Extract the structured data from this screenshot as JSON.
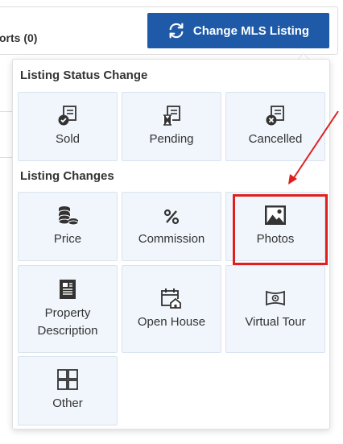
{
  "topbar": {
    "reports_label": "orts",
    "reports_count": "(0)",
    "change_button_label": "Change MLS Listing"
  },
  "dropdown": {
    "status_section_title": "Listing Status Change",
    "changes_section_title": "Listing Changes",
    "status_items": [
      {
        "label": "Sold",
        "icon": "sold-icon"
      },
      {
        "label": "Pending",
        "icon": "pending-icon"
      },
      {
        "label": "Cancelled",
        "icon": "cancelled-icon"
      }
    ],
    "change_items": [
      {
        "label": "Price",
        "icon": "coins-icon"
      },
      {
        "label": "Commission",
        "icon": "percent-icon"
      },
      {
        "label": "Photos",
        "icon": "photo-icon"
      },
      {
        "label": "Property Description",
        "icon": "document-icon"
      },
      {
        "label": "Open House",
        "icon": "calendar-house-icon"
      },
      {
        "label": "Virtual Tour",
        "icon": "panorama-icon"
      },
      {
        "label": "Other",
        "icon": "grid-icon"
      }
    ]
  },
  "colors": {
    "button_bg": "#1e5aa8",
    "tile_bg": "#f1f6fc",
    "highlight": "#e01f1f",
    "icon": "#333333"
  }
}
